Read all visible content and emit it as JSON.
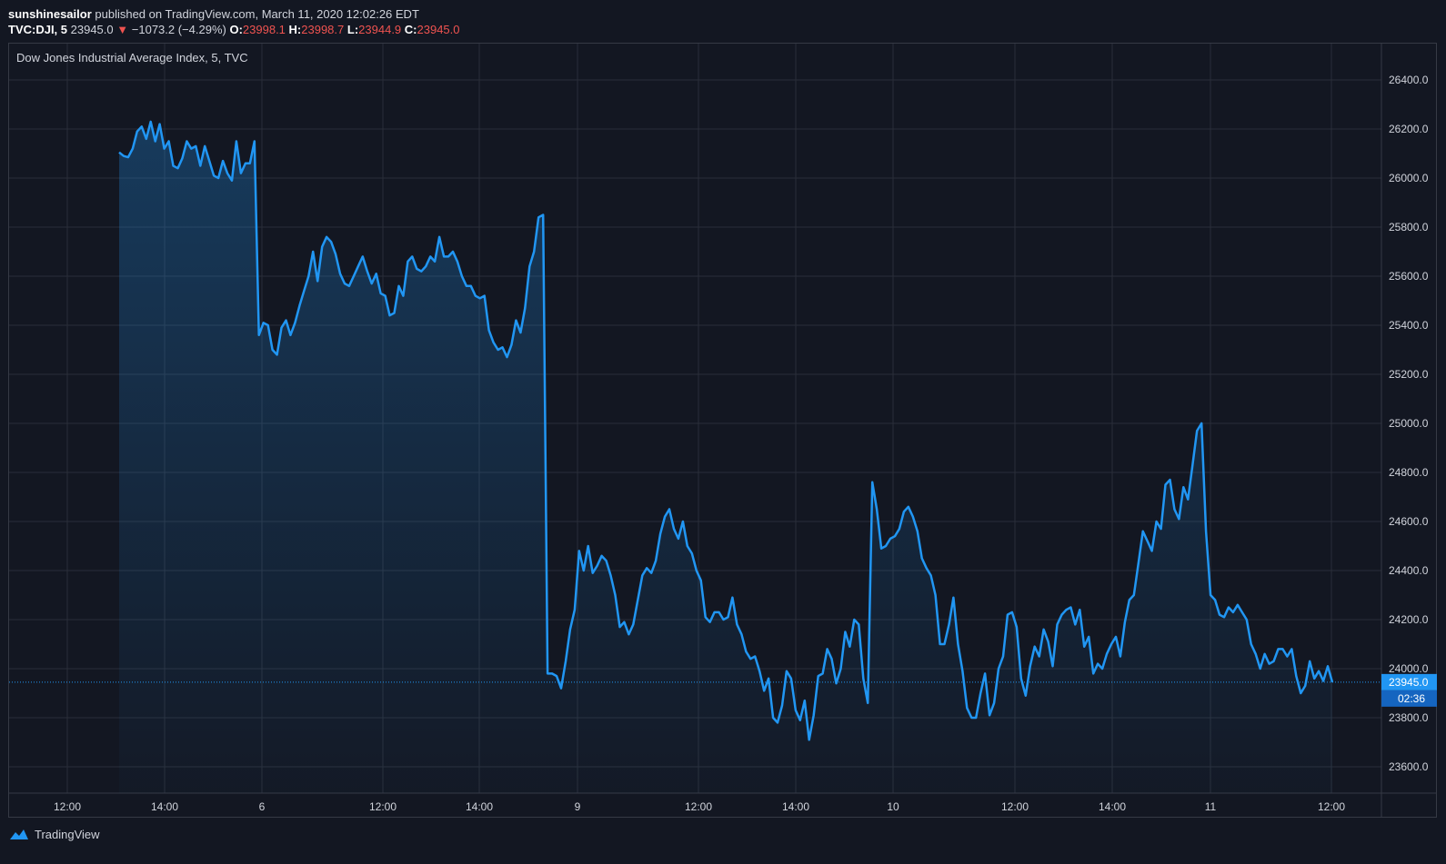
{
  "header": {
    "publisher": "sunshinesailor",
    "published_text": "published on TradingView.com, March 11, 2020 12:02:26 EDT",
    "symbol": "TVC:DJI, 5",
    "last": "23945.0",
    "change": "−1073.2 (−4.29%)",
    "o_label": "O:",
    "o_value": "23998.1",
    "h_label": "H:",
    "h_value": "23998.7",
    "l_label": "L:",
    "l_value": "23944.9",
    "c_label": "C:",
    "c_value": "23945.0"
  },
  "legend": {
    "title": "Dow Jones Industrial Average Index, 5, TVC"
  },
  "price_badge": {
    "price": "23945.0",
    "countdown": "02:36"
  },
  "footer": {
    "brand": "TradingView",
    "icon": "tradingview-logo-icon"
  },
  "colors": {
    "line": "#2196f3",
    "down": "#ef5350",
    "background": "#131722",
    "grid": "#2a2e39"
  },
  "chart_data": {
    "type": "area",
    "title": "Dow Jones Industrial Average Index, 5, TVC",
    "y_ticks": [
      "26400.0",
      "26200.0",
      "26000.0",
      "25800.0",
      "25600.0",
      "25400.0",
      "25200.0",
      "25000.0",
      "24800.0",
      "24600.0",
      "24400.0",
      "24200.0",
      "24000.0",
      "23800.0",
      "23600.0"
    ],
    "x_ticks": [
      "12:00",
      "14:00",
      "6",
      "12:00",
      "14:00",
      "9",
      "12:00",
      "14:00",
      "10",
      "12:00",
      "14:00",
      "11",
      "12:00"
    ],
    "ylim": [
      23500,
      26500
    ],
    "grid": true,
    "last_price": 23945.0,
    "series": [
      {
        "values": [
          26105,
          26090,
          26085,
          26120,
          26190,
          26210,
          26160,
          26230,
          26150,
          26220,
          26120,
          26150,
          26050,
          26040,
          26080,
          26150,
          26120,
          26130,
          26050,
          26130,
          26070,
          26010,
          26000,
          26070,
          26020,
          25990,
          26150,
          26020,
          26060,
          26060,
          26150,
          25360,
          25410,
          25400,
          25300,
          25280,
          25390,
          25420,
          25360,
          25410,
          25480,
          25540,
          25600,
          25700,
          25580,
          25720,
          25760,
          25740,
          25690,
          25610,
          25570,
          25560,
          25600,
          25640,
          25680,
          25620,
          25570,
          25610,
          25530,
          25520,
          25440,
          25450,
          25560,
          25520,
          25660,
          25680,
          25630,
          25620,
          25640,
          25680,
          25660,
          25760,
          25680,
          25680,
          25700,
          25660,
          25600,
          25560,
          25560,
          25520,
          25510,
          25520,
          25380,
          25330,
          25300,
          25310,
          25270,
          25320,
          25420,
          25370,
          25470,
          25640,
          25700,
          25840,
          25850,
          23980,
          23980,
          23970,
          23920,
          24030,
          24160,
          24240,
          24480,
          24400,
          24500,
          24390,
          24420,
          24460,
          24440,
          24380,
          24300,
          24170,
          24190,
          24140,
          24180,
          24280,
          24380,
          24410,
          24390,
          24440,
          24550,
          24620,
          24650,
          24570,
          24530,
          24600,
          24500,
          24470,
          24400,
          24360,
          24210,
          24190,
          24230,
          24230,
          24200,
          24210,
          24290,
          24180,
          24140,
          24070,
          24040,
          24050,
          23990,
          23910,
          23960,
          23800,
          23780,
          23850,
          23990,
          23960,
          23830,
          23790,
          23870,
          23710,
          23810,
          23970,
          23980,
          24080,
          24040,
          23940,
          24000,
          24150,
          24090,
          24200,
          24180,
          23960,
          23860,
          24760,
          24650,
          24490,
          24500,
          24530,
          24540,
          24570,
          24640,
          24660,
          24620,
          24560,
          24450,
          24410,
          24380,
          24300,
          24100,
          24100,
          24180,
          24290,
          24100,
          23990,
          23840,
          23800,
          23800,
          23900,
          23980,
          23810,
          23860,
          24000,
          24050,
          24220,
          24230,
          24170,
          23960,
          23890,
          24010,
          24090,
          24050,
          24160,
          24110,
          24010,
          24180,
          24220,
          24240,
          24250,
          24180,
          24240,
          24090,
          24130,
          23980,
          24020,
          24000,
          24060,
          24100,
          24130,
          24050,
          24190,
          24280,
          24300,
          24430,
          24560,
          24520,
          24480,
          24600,
          24570,
          24750,
          24770,
          24650,
          24610,
          24740,
          24690,
          24830,
          24970,
          25000,
          24560,
          24300,
          24280,
          24220,
          24210,
          24250,
          24230,
          24260,
          24230,
          24200,
          24100,
          24060,
          24000,
          24060,
          24020,
          24030,
          24080,
          24080,
          24050,
          24080,
          23970,
          23900,
          23930,
          24030,
          23960,
          23990,
          23950,
          24010,
          23945
        ]
      }
    ]
  }
}
